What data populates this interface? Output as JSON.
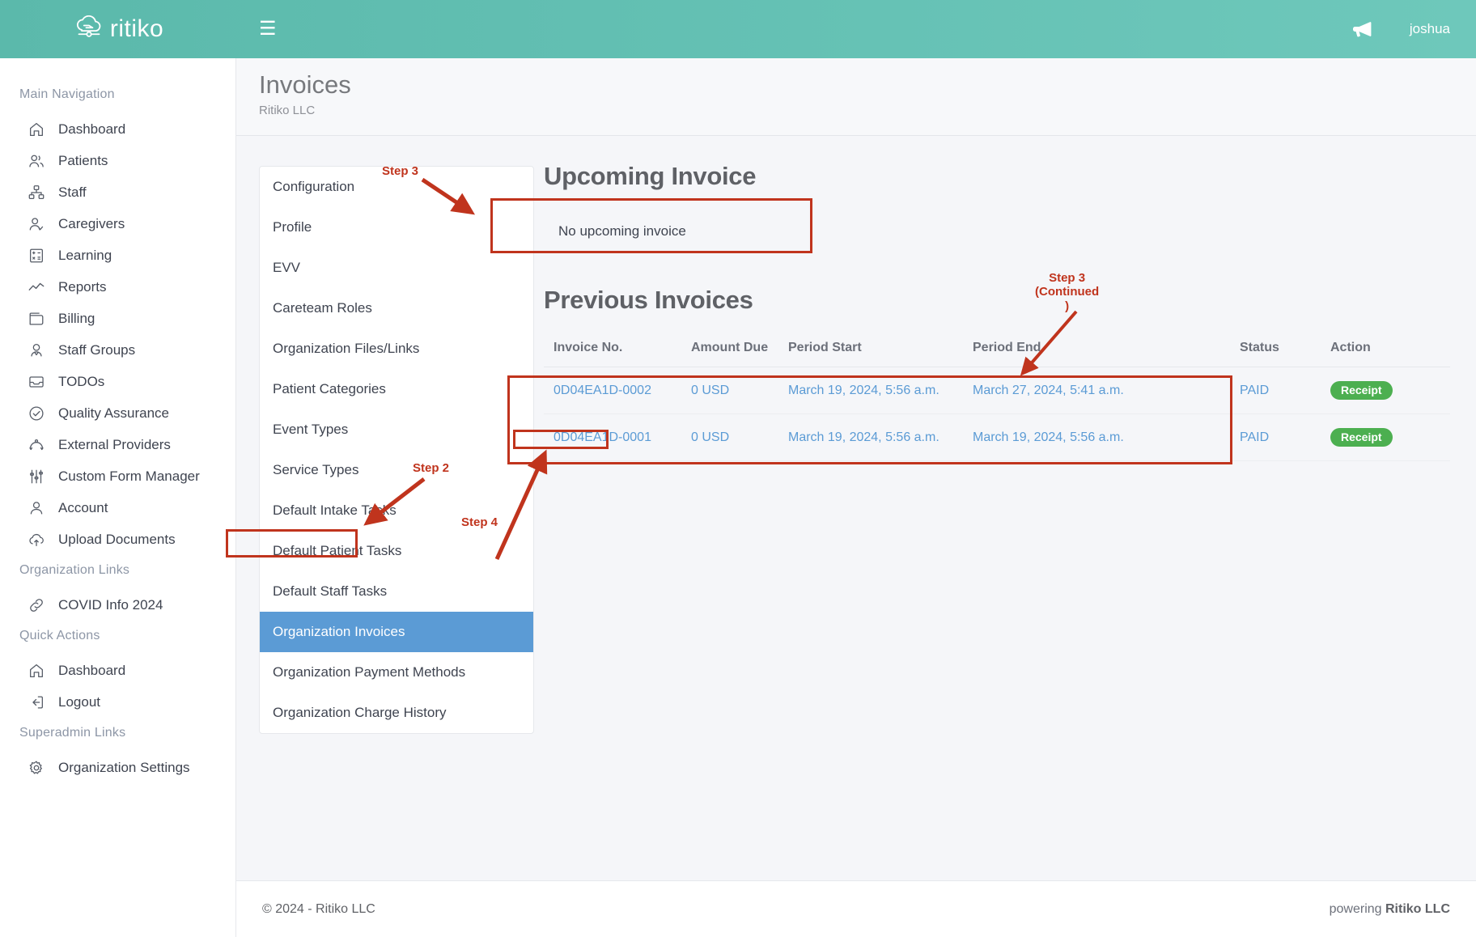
{
  "topbar": {
    "brand_name": "ritiko",
    "menu_icon": "hamburger-icon",
    "announcement_icon": "megaphone-icon",
    "username": "joshua"
  },
  "sidebar": {
    "sections": [
      {
        "title": "Main Navigation",
        "items": [
          {
            "label": "Dashboard",
            "icon": "home-icon"
          },
          {
            "label": "Patients",
            "icon": "patients-icon"
          },
          {
            "label": "Staff",
            "icon": "org-chart-icon"
          },
          {
            "label": "Caregivers",
            "icon": "user-check-icon"
          },
          {
            "label": "Learning",
            "icon": "calculator-icon"
          },
          {
            "label": "Reports",
            "icon": "line-chart-icon"
          },
          {
            "label": "Billing",
            "icon": "wallet-icon"
          },
          {
            "label": "Staff Groups",
            "icon": "user-badge-icon"
          },
          {
            "label": "TODOs",
            "icon": "inbox-icon"
          },
          {
            "label": "Quality Assurance",
            "icon": "check-circle-icon"
          },
          {
            "label": "External Providers",
            "icon": "network-icon"
          },
          {
            "label": "Custom Form Manager",
            "icon": "sliders-icon"
          },
          {
            "label": "Account",
            "icon": "user-icon"
          },
          {
            "label": "Upload Documents",
            "icon": "cloud-upload-icon"
          }
        ]
      },
      {
        "title": "Organization Links",
        "items": [
          {
            "label": "COVID Info 2024",
            "icon": "link-icon"
          }
        ]
      },
      {
        "title": "Quick Actions",
        "items": [
          {
            "label": "Dashboard",
            "icon": "home-icon"
          },
          {
            "label": "Logout",
            "icon": "logout-icon"
          }
        ]
      },
      {
        "title": "Superadmin Links",
        "items": [
          {
            "label": "Organization Settings",
            "icon": "gear-icon"
          }
        ]
      }
    ]
  },
  "page": {
    "title": "Invoices",
    "subtitle": "Ritiko LLC"
  },
  "settings_menu": {
    "items": [
      {
        "label": "Configuration",
        "active": false
      },
      {
        "label": "Profile",
        "active": false
      },
      {
        "label": "EVV",
        "active": false
      },
      {
        "label": "Careteam Roles",
        "active": false
      },
      {
        "label": "Organization Files/Links",
        "active": false
      },
      {
        "label": "Patient Categories",
        "active": false
      },
      {
        "label": "Event Types",
        "active": false
      },
      {
        "label": "Service Types",
        "active": false
      },
      {
        "label": "Default Intake Tasks",
        "active": false
      },
      {
        "label": "Default Patient Tasks",
        "active": false
      },
      {
        "label": "Default Staff Tasks",
        "active": false
      },
      {
        "label": "Organization Invoices",
        "active": true
      },
      {
        "label": "Organization Payment Methods",
        "active": false
      },
      {
        "label": "Organization Charge History",
        "active": false
      }
    ]
  },
  "upcoming": {
    "heading": "Upcoming Invoice",
    "empty_text": "No upcoming invoice"
  },
  "previous": {
    "heading": "Previous Invoices",
    "columns": [
      "Invoice No.",
      "Amount Due",
      "Period Start",
      "Period End",
      "Status",
      "Action"
    ],
    "rows": [
      {
        "invoice_no": "0D04EA1D-0002",
        "amount_due": "0 USD",
        "period_start": "March 19, 2024, 5:56 a.m.",
        "period_end": "March 27, 2024, 5:41 a.m.",
        "status": "PAID",
        "action": "Receipt"
      },
      {
        "invoice_no": "0D04EA1D-0001",
        "amount_due": "0 USD",
        "period_start": "March 19, 2024, 5:56 a.m.",
        "period_end": "March 19, 2024, 5:56 a.m.",
        "status": "PAID",
        "action": "Receipt"
      }
    ]
  },
  "footer": {
    "copyright": "© 2024 - Ritiko LLC",
    "powering_prefix": "powering ",
    "powering_brand": "Ritiko LLC"
  },
  "annotations": {
    "step3": "Step 3",
    "step3_continued": "Step 3\n(Continued\n)",
    "step2": "Step 2",
    "step4": "Step 4"
  },
  "colors": {
    "brand_teal": "#62bfb2",
    "active_blue": "#5b9bd5",
    "link_blue": "#5b9bd5",
    "badge_green": "#4caf50",
    "annotation_red": "#c0341d"
  }
}
